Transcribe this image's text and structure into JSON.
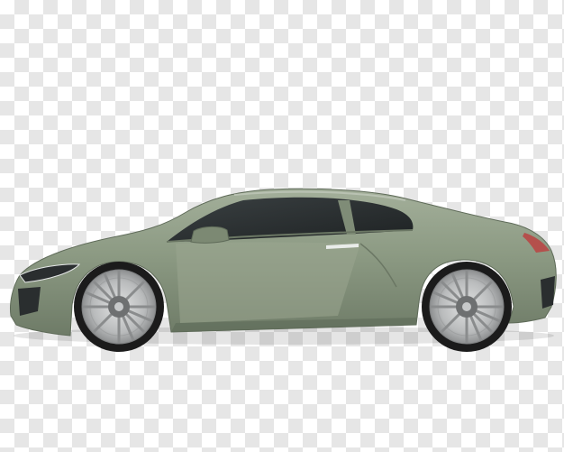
{
  "image": {
    "subject": "car-icon",
    "background": "checkerboard",
    "colors": {
      "body": "#8c9a83",
      "body_shadow": "#6f7c68",
      "body_highlight": "#a7b39e",
      "glass": "#2b2f30",
      "tire": "#1b1b1b",
      "rim": "#c9cbcc",
      "checker_light": "#ffffff",
      "checker_dark": "#e6e6e6"
    }
  }
}
